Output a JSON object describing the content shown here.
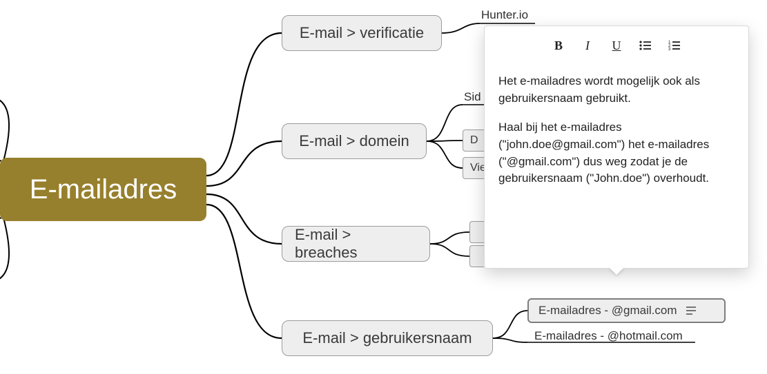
{
  "root": {
    "label": "E-mailadres",
    "color": "#97802d"
  },
  "branches": [
    {
      "id": "verif",
      "label": "E-mail > verificatie"
    },
    {
      "id": "domein",
      "label": "E-mail > domein"
    },
    {
      "id": "breach",
      "label": "E-mail > breaches"
    },
    {
      "id": "gebr",
      "label": "E-mail > gebruikersnaam"
    }
  ],
  "leaves": {
    "verif_hunter": "Hunter.io",
    "domein_sid_partial": "Sid",
    "domein_do_partial": "D",
    "domein_vie_partial": "Vie",
    "gebr_gmail": "E-mailadres - @gmail.com",
    "gebr_hotmail": "E-mailadres - @hotmail.com"
  },
  "popup": {
    "toolbar": {
      "bold": "B",
      "italic": "I",
      "underline": "U"
    },
    "paragraphs": [
      "Het e-mailadres wordt mogelijk ook als gebruikersnaam gebruikt.",
      "Haal bij het e-mailadres (\"john.doe@gmail.com\") het e-mailadres (\"@gmail.com\") dus weg zodat je de gebruikersnaam (\"John.doe\") overhoudt."
    ]
  }
}
